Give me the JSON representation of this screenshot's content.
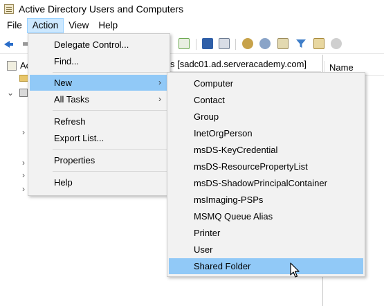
{
  "window": {
    "title": "Active Directory Users and Computers"
  },
  "menubar": {
    "items": [
      "File",
      "Action",
      "View",
      "Help"
    ]
  },
  "tree": {
    "root_label": "Ac",
    "domain_header": "s [sadc01.ad.serveracademy.com]"
  },
  "right_pane": {
    "column_name": "Name"
  },
  "action_menu": {
    "items": [
      {
        "label": "Delegate Control..."
      },
      {
        "label": "Find..."
      },
      {
        "label": "New"
      },
      {
        "label": "All Tasks"
      },
      {
        "label": "Refresh"
      },
      {
        "label": "Export List..."
      },
      {
        "label": "Properties"
      },
      {
        "label": "Help"
      }
    ],
    "submenu_arrow": "›",
    "highlighted": "New"
  },
  "new_submenu": {
    "items": [
      "Computer",
      "Contact",
      "Group",
      "InetOrgPerson",
      "msDS-KeyCredential",
      "msDS-ResourcePropertyList",
      "msDS-ShadowPrincipalContainer",
      "msImaging-PSPs",
      "MSMQ Queue Alias",
      "Printer",
      "User",
      "Shared Folder"
    ],
    "highlighted": "Shared Folder"
  },
  "colors": {
    "highlight": "#91c9f7",
    "menu_bg": "#f2f2f2",
    "menubar_active": "#cce8ff"
  }
}
